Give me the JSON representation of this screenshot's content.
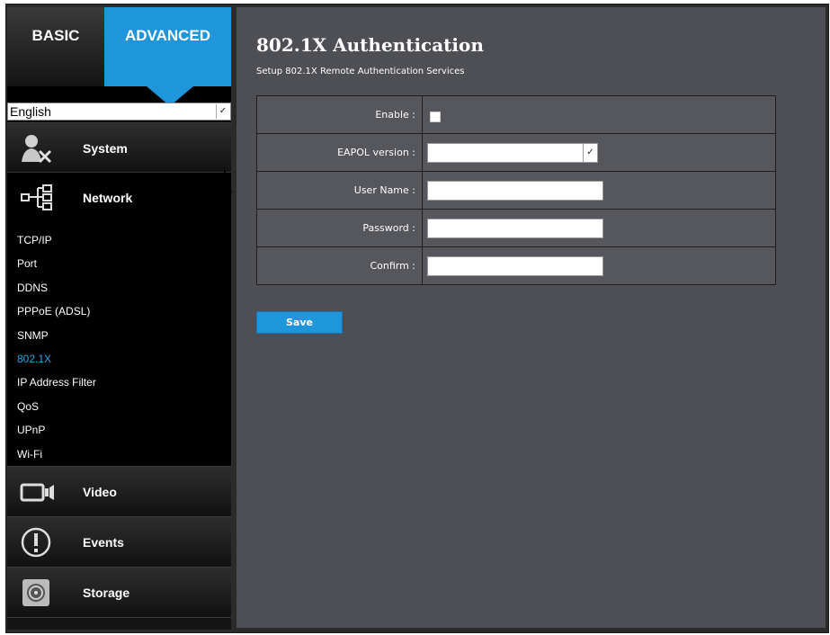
{
  "tabs": {
    "basic": "BASIC",
    "advanced": "ADVANCED"
  },
  "language": {
    "selected": "English"
  },
  "sidebar": {
    "sections": {
      "system": "System",
      "network": "Network",
      "video": "Video",
      "events": "Events",
      "storage": "Storage"
    },
    "network_items": [
      "TCP/IP",
      "Port",
      "DDNS",
      "PPPoE (ADSL)",
      "SNMP",
      "802.1X",
      "IP Address Filter",
      "QoS",
      "UPnP",
      "Wi-Fi"
    ],
    "active_item": "802.1X"
  },
  "page": {
    "title": "802.1X Authentication",
    "subtitle": "Setup 802.1X Remote Authentication Services"
  },
  "form": {
    "enable_label": "Enable :",
    "enable_checked": false,
    "eapol_label": "EAPOL version :",
    "eapol_value": "",
    "username_label": "User Name :",
    "username_value": "",
    "password_label": "Password :",
    "password_value": "",
    "confirm_label": "Confirm :",
    "confirm_value": ""
  },
  "save_label": "Save",
  "colors": {
    "accent": "#1f95dc",
    "active_link": "#2aa3e8",
    "panel": "#4e4f54"
  }
}
